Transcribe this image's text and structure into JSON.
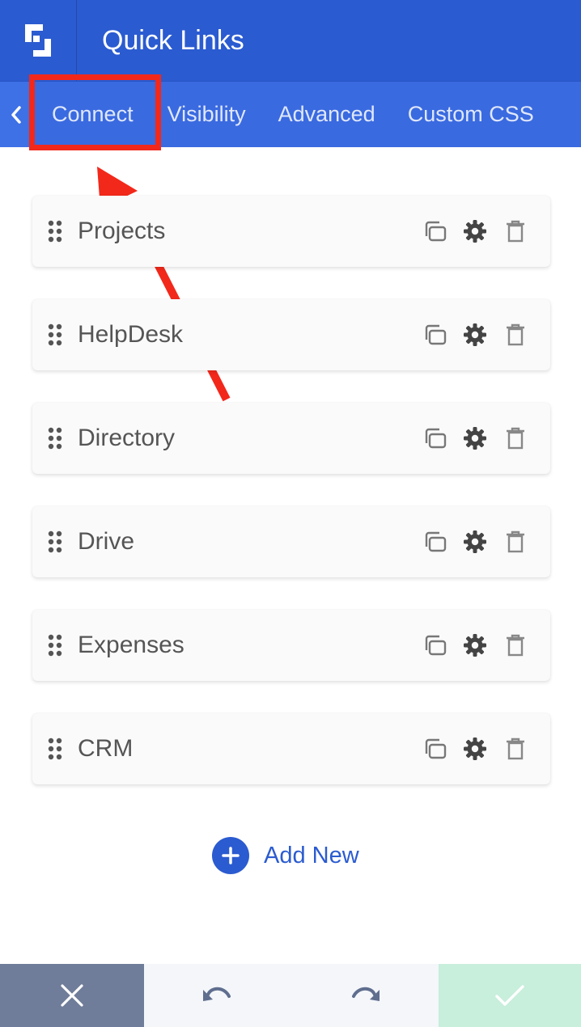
{
  "header": {
    "title": "Quick Links",
    "logo_icon": "logo-icon"
  },
  "tabs": {
    "back_icon": "chevron-left-icon",
    "items": [
      {
        "label": "Connect",
        "highlighted": true
      },
      {
        "label": "Visibility"
      },
      {
        "label": "Advanced"
      },
      {
        "label": "Custom CSS"
      }
    ]
  },
  "list": {
    "items": [
      {
        "label": "Projects"
      },
      {
        "label": "HelpDesk"
      },
      {
        "label": "Directory"
      },
      {
        "label": "Drive"
      },
      {
        "label": "Expenses"
      },
      {
        "label": "CRM"
      }
    ],
    "item_icons": [
      "drag-handle-icon",
      "duplicate-icon",
      "gear-icon",
      "trash-icon"
    ]
  },
  "add_new": {
    "label": "Add New",
    "icon": "plus-circle-icon"
  },
  "footer": {
    "icons": [
      "close-icon",
      "undo-icon",
      "redo-icon",
      "check-icon"
    ]
  },
  "colors": {
    "header_bg": "#2b5bd0",
    "tabs_bg": "#3a6ae0",
    "highlight": "#f2281b",
    "accent": "#2b5bd0",
    "cancel_bg": "#6f7d9a",
    "save_bg": "#c8eedc"
  }
}
